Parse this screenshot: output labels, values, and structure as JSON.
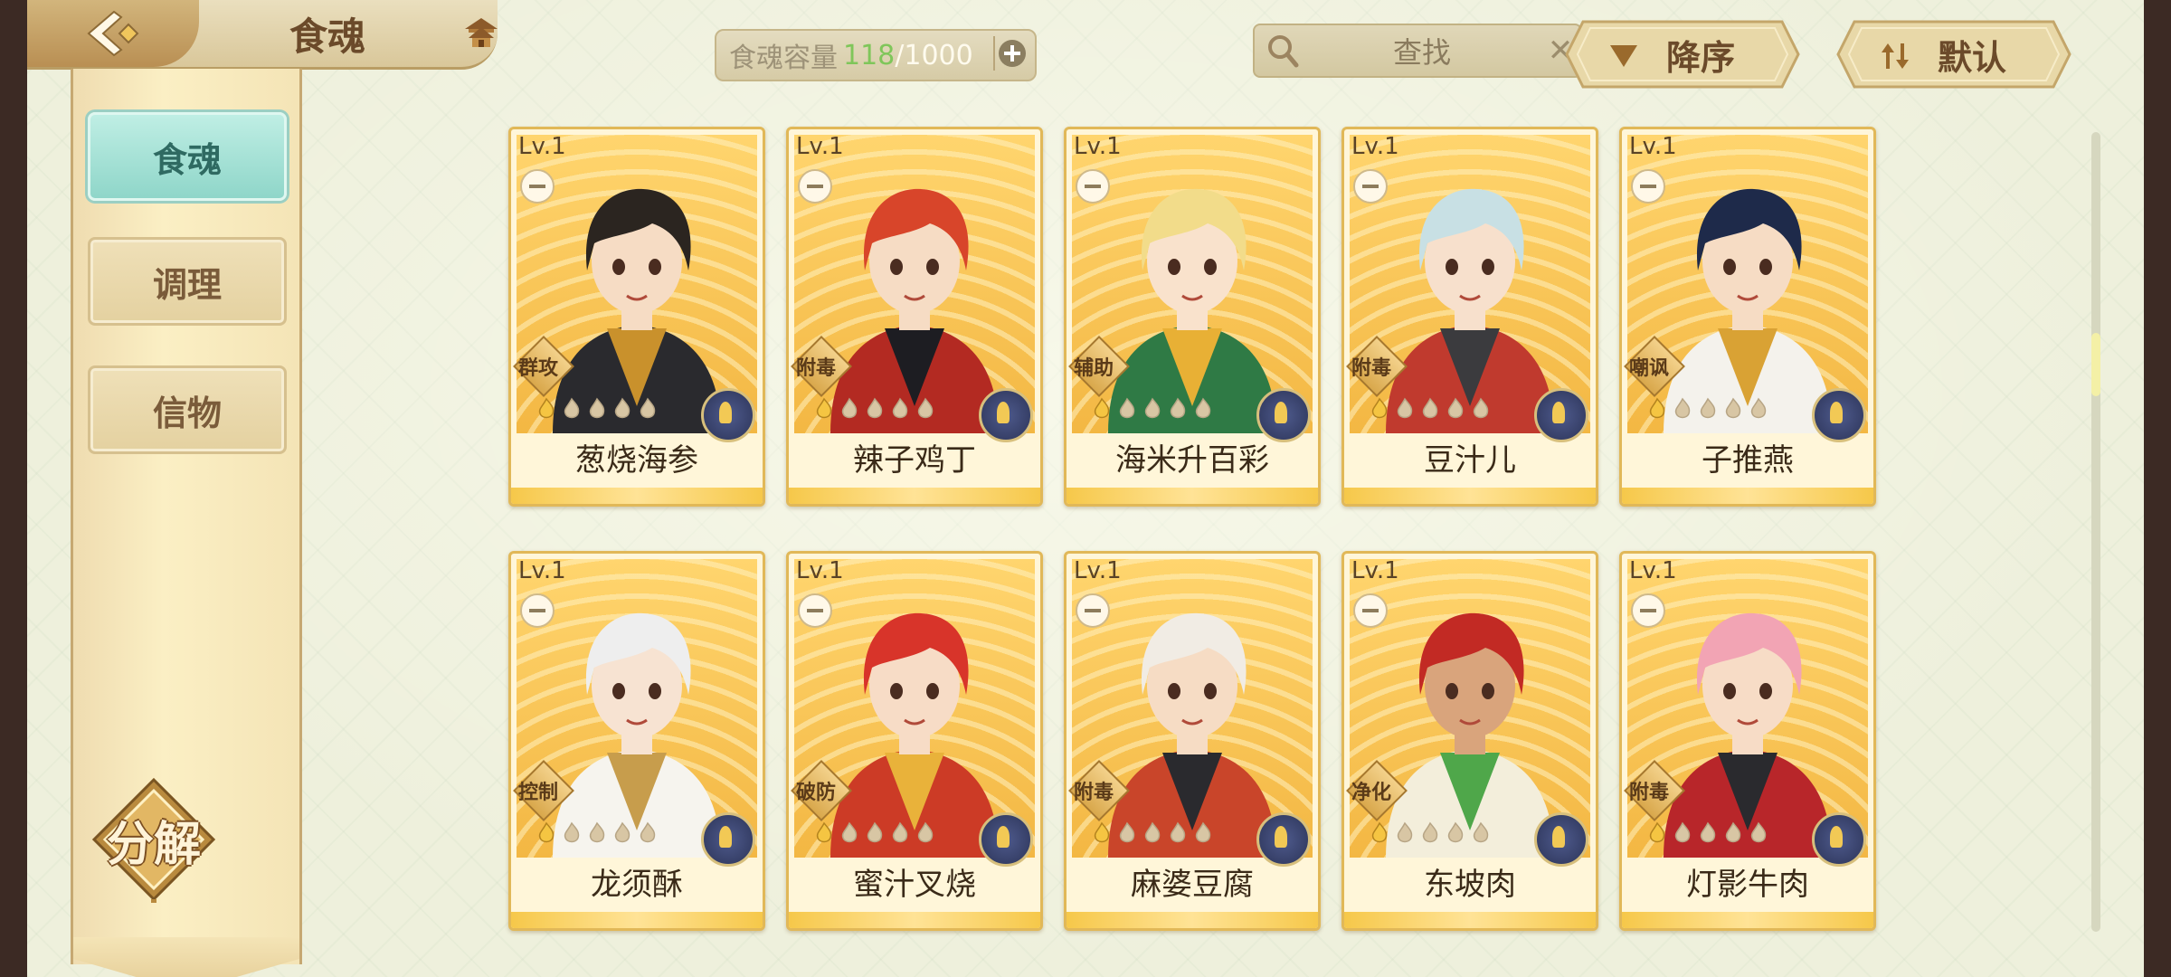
{
  "header": {
    "title": "食魂",
    "capacity_label": "食魂容量",
    "capacity_current": "118",
    "capacity_sep": "/",
    "capacity_max": "1000",
    "search_placeholder": "查找",
    "sort_order_label": "降序",
    "sort_mode_label": "默认"
  },
  "sidebar": {
    "tabs": [
      {
        "label": "食魂",
        "active": true
      },
      {
        "label": "调理",
        "active": false
      },
      {
        "label": "信物",
        "active": false
      }
    ],
    "decompose_label": "分解"
  },
  "cards": [
    {
      "level": "Lv.1",
      "role": "群攻",
      "name": "葱烧海参",
      "hair": "#2b2520",
      "outfit": "#2a2a2e",
      "accent": "#c9912c",
      "skin": "#f6dcc4"
    },
    {
      "level": "Lv.1",
      "role": "附毒",
      "name": "辣子鸡丁",
      "hair": "#d8452a",
      "outfit": "#b32a22",
      "accent": "#1d1d22",
      "skin": "#f6dcc4"
    },
    {
      "level": "Lv.1",
      "role": "辅助",
      "name": "海米升百彩",
      "hair": "#f2dc8a",
      "outfit": "#2f7a45",
      "accent": "#e8b035",
      "skin": "#f9e2cc"
    },
    {
      "level": "Lv.1",
      "role": "附毒",
      "name": "豆汁儿",
      "hair": "#c8e0e4",
      "outfit": "#c03a2e",
      "accent": "#3b3b3e",
      "skin": "#f7e0cc"
    },
    {
      "level": "Lv.1",
      "role": "嘲讽",
      "name": "子推燕",
      "hair": "#1e2a4a",
      "outfit": "#f4f2ec",
      "accent": "#d9a234",
      "skin": "#f6dcc4"
    },
    {
      "level": "Lv.1",
      "role": "控制",
      "name": "龙须酥",
      "hair": "#eeeeee",
      "outfit": "#f6f4ee",
      "accent": "#c79d4c",
      "skin": "#f7e3d2"
    },
    {
      "level": "Lv.1",
      "role": "破防",
      "name": "蜜汁叉烧",
      "hair": "#d8342a",
      "outfit": "#cc3b26",
      "accent": "#e9b23a",
      "skin": "#f7dcc6"
    },
    {
      "level": "Lv.1",
      "role": "附毒",
      "name": "麻婆豆腐",
      "hair": "#f1ece4",
      "outfit": "#c9452a",
      "accent": "#2a2a2e",
      "skin": "#f6dcc4"
    },
    {
      "level": "Lv.1",
      "role": "净化",
      "name": "东坡肉",
      "hair": "#c22a24",
      "outfit": "#f3eedb",
      "accent": "#4fa74a",
      "skin": "#d9a47c"
    },
    {
      "level": "Lv.1",
      "role": "附毒",
      "name": "灯影牛肉",
      "hair": "#f2a4b4",
      "outfit": "#b8262a",
      "accent": "#2a2a2e",
      "skin": "#f7dcc6"
    }
  ],
  "colors": {
    "accent_teal": "#8fd6c9",
    "gold_border": "#e1b858",
    "capacity_current": "#7fc65a"
  },
  "icons": {
    "back": "back-arrow-icon",
    "home": "pagoda-icon",
    "search": "magnifier-icon",
    "clear": "close-icon",
    "sort_order": "triangle-down-icon",
    "sort_mode": "sort-arrows-icon",
    "add": "plus-icon",
    "star": "flame-star-icon",
    "emblem": "element-emblem-icon"
  }
}
